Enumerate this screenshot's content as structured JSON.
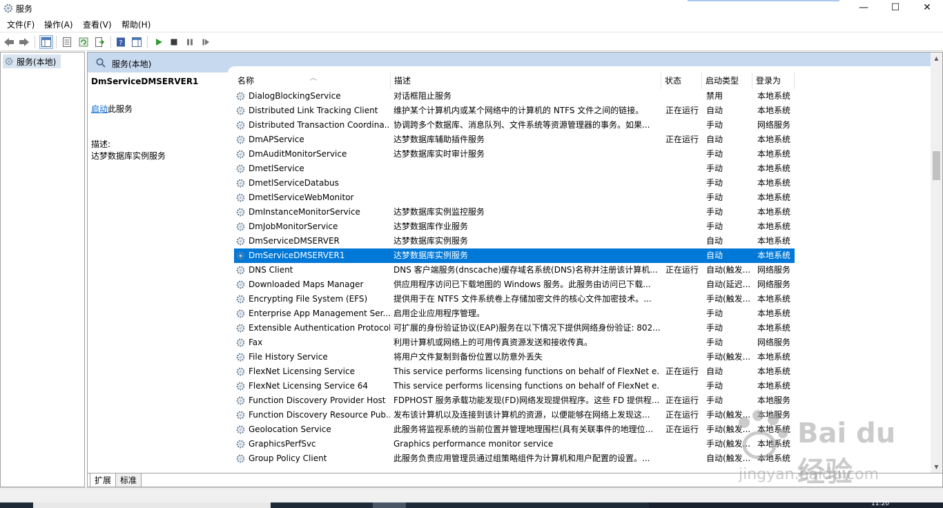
{
  "window": {
    "title": "服务",
    "controls": {
      "minimize": "—",
      "maximize": "☐",
      "close": "✕"
    }
  },
  "menu": [
    "文件(F)",
    "操作(A)",
    "查看(V)",
    "帮助(H)"
  ],
  "toolbar": {
    "icons": [
      "back-icon",
      "forward-icon",
      "show-hide-tree-icon",
      "properties-icon",
      "refresh-icon",
      "export-list-icon",
      "help-icon",
      "show-hide-action-pane-icon",
      "start-service-icon",
      "stop-service-icon",
      "pause-service-icon",
      "resume-service-icon"
    ]
  },
  "tree": {
    "root_label": "服务(本地)"
  },
  "content_header": "服务(本地)",
  "extended": {
    "service_name": "DmServiceDMSERVER1",
    "start_link": "启动",
    "start_suffix": "此服务",
    "desc_label": "描述:",
    "desc_text": "达梦数据库实例服务"
  },
  "columns": [
    "名称",
    "描述",
    "状态",
    "启动类型",
    "登录为"
  ],
  "services": [
    {
      "name": "DialogBlockingService",
      "desc": "对话框阻止服务",
      "status": "",
      "startup": "禁用",
      "logon": "本地系统"
    },
    {
      "name": "Distributed Link Tracking Client",
      "desc": "维护某个计算机内或某个网络中的计算机的 NTFS 文件之间的链接。",
      "status": "正在运行",
      "startup": "自动",
      "logon": "本地系统"
    },
    {
      "name": "Distributed Transaction Coordina...",
      "desc": "协调跨多个数据库、消息队列、文件系统等资源管理器的事务。如果...",
      "status": "",
      "startup": "手动",
      "logon": "网络服务"
    },
    {
      "name": "DmAPService",
      "desc": "达梦数据库辅助插件服务",
      "status": "正在运行",
      "startup": "自动",
      "logon": "本地系统"
    },
    {
      "name": "DmAuditMonitorService",
      "desc": "达梦数据库实时审计服务",
      "status": "",
      "startup": "手动",
      "logon": "本地系统"
    },
    {
      "name": "DmetlService",
      "desc": "",
      "status": "",
      "startup": "手动",
      "logon": "本地系统"
    },
    {
      "name": "DmetlServiceDatabus",
      "desc": "",
      "status": "",
      "startup": "手动",
      "logon": "本地系统"
    },
    {
      "name": "DmetlServiceWebMonitor",
      "desc": "",
      "status": "",
      "startup": "手动",
      "logon": "本地系统"
    },
    {
      "name": "DmInstanceMonitorService",
      "desc": "达梦数据库实例监控服务",
      "status": "",
      "startup": "手动",
      "logon": "本地系统"
    },
    {
      "name": "DmJobMonitorService",
      "desc": "达梦数据库作业服务",
      "status": "",
      "startup": "手动",
      "logon": "本地系统"
    },
    {
      "name": "DmServiceDMSERVER",
      "desc": "达梦数据库实例服务",
      "status": "",
      "startup": "自动",
      "logon": "本地系统"
    },
    {
      "name": "DmServiceDMSERVER1",
      "desc": "达梦数据库实例服务",
      "status": "",
      "startup": "自动",
      "logon": "本地系统",
      "selected": true
    },
    {
      "name": "DNS Client",
      "desc": "DNS 客户端服务(dnscache)缓存域名系统(DNS)名称并注册该计算机...",
      "status": "正在运行",
      "startup": "自动(触发...",
      "logon": "网络服务"
    },
    {
      "name": "Downloaded Maps Manager",
      "desc": "供应用程序访问已下载地图的 Windows 服务。此服务由访问已下载...",
      "status": "",
      "startup": "自动(延迟...",
      "logon": "网络服务"
    },
    {
      "name": "Encrypting File System (EFS)",
      "desc": "提供用于在 NTFS 文件系统卷上存储加密文件的核心文件加密技术。...",
      "status": "",
      "startup": "手动(触发...",
      "logon": "本地系统"
    },
    {
      "name": "Enterprise App Management Ser...",
      "desc": "启用企业应用程序管理。",
      "status": "",
      "startup": "手动",
      "logon": "本地系统"
    },
    {
      "name": "Extensible Authentication Protocol",
      "desc": "可扩展的身份验证协议(EAP)服务在以下情况下提供网络身份验证: 802...",
      "status": "",
      "startup": "手动",
      "logon": "本地系统"
    },
    {
      "name": "Fax",
      "desc": "利用计算机或网络上的可用传真资源发送和接收传真。",
      "status": "",
      "startup": "手动",
      "logon": "网络服务"
    },
    {
      "name": "File History Service",
      "desc": "将用户文件复制到备份位置以防意外丢失",
      "status": "",
      "startup": "手动(触发...",
      "logon": "本地系统"
    },
    {
      "name": "FlexNet Licensing Service",
      "desc": "This service performs licensing functions on behalf of FlexNet e...",
      "status": "正在运行",
      "startup": "自动",
      "logon": "本地系统"
    },
    {
      "name": "FlexNet Licensing Service 64",
      "desc": "This service performs licensing functions on behalf of FlexNet e...",
      "status": "",
      "startup": "手动",
      "logon": "本地系统"
    },
    {
      "name": "Function Discovery Provider Host",
      "desc": "FDPHOST 服务承载功能发现(FD)网络发现提供程序。这些 FD 提供程...",
      "status": "正在运行",
      "startup": "手动",
      "logon": "本地服务"
    },
    {
      "name": "Function Discovery Resource Pub...",
      "desc": "发布该计算机以及连接到该计算机的资源，以便能够在网络上发现这...",
      "status": "正在运行",
      "startup": "手动(触发...",
      "logon": "本地服务"
    },
    {
      "name": "Geolocation Service",
      "desc": "此服务将监视系统的当前位置并管理地理围栏(具有关联事件的地理位...",
      "status": "正在运行",
      "startup": "手动(触发...",
      "logon": "本地系统"
    },
    {
      "name": "GraphicsPerfSvc",
      "desc": "Graphics performance monitor service",
      "status": "",
      "startup": "手动(触发...",
      "logon": "本地系统"
    },
    {
      "name": "Group Policy Client",
      "desc": "此服务负责应用管理员通过组策略组件为计算机和用户配置的设置。...",
      "status": "",
      "startup": "自动(触发...",
      "logon": "本地系统"
    }
  ],
  "bottom_tabs": [
    "扩展",
    "标准"
  ],
  "taskbar": {
    "clock": "11:20"
  },
  "watermark": {
    "brand": "Bai du 经验",
    "url": "jingyan.baidu.com"
  }
}
